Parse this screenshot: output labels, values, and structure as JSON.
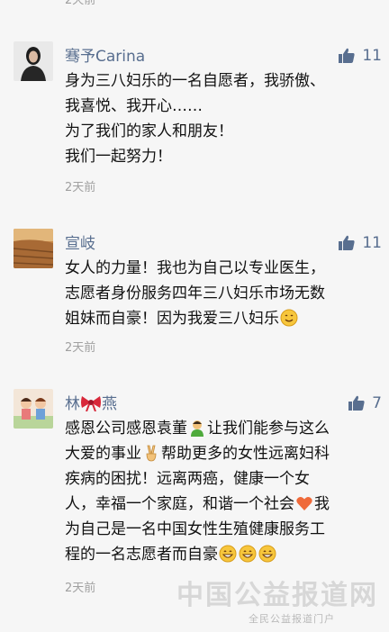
{
  "top_partial": {
    "time": "2天前"
  },
  "comments": [
    {
      "name": "骞予Carina",
      "likes": "11",
      "lines": [
        "身为三八妇乐的一名自愿者，我骄傲、",
        "我喜悦、我开心……",
        "为了我们的家人和朋友！",
        "我们一起努力！"
      ],
      "time": "2天前"
    },
    {
      "name": "宣岐",
      "likes": "11",
      "lines": [
        "女人的力量！我也为自己以专业医生，",
        "志愿者身份服务四年三八妇乐市场无数",
        "姐妹而自豪！因为我爱三八妇乐"
      ],
      "time": "2天前"
    },
    {
      "name_prefix": "林",
      "name_suffix": "燕",
      "likes": "7",
      "lines": [
        "感恩公司感恩袁董",
        "让我们能参与这么",
        "大爱的事业",
        "帮助更多的女性远离妇科",
        "疾病的困扰！远离两癌，健康一个女",
        "人，幸福一个家庭，和谐一个社会",
        "我",
        "为自己是一名中国女性生殖健康服务工",
        "程的一名志愿者而自豪"
      ],
      "time": "2天前"
    }
  ],
  "watermark": {
    "title": "中国公益报道网",
    "subtitle": "全民公益报道门户"
  },
  "colors": {
    "name": "#586e8f",
    "time": "#a0a0a0",
    "background": "#f6f6f6"
  },
  "icons": [
    "thumbs-up-icon",
    "smile-emoji",
    "bow-emoji",
    "person-emoji",
    "victory-hand-emoji",
    "heart-emoji",
    "grin-emoji"
  ]
}
